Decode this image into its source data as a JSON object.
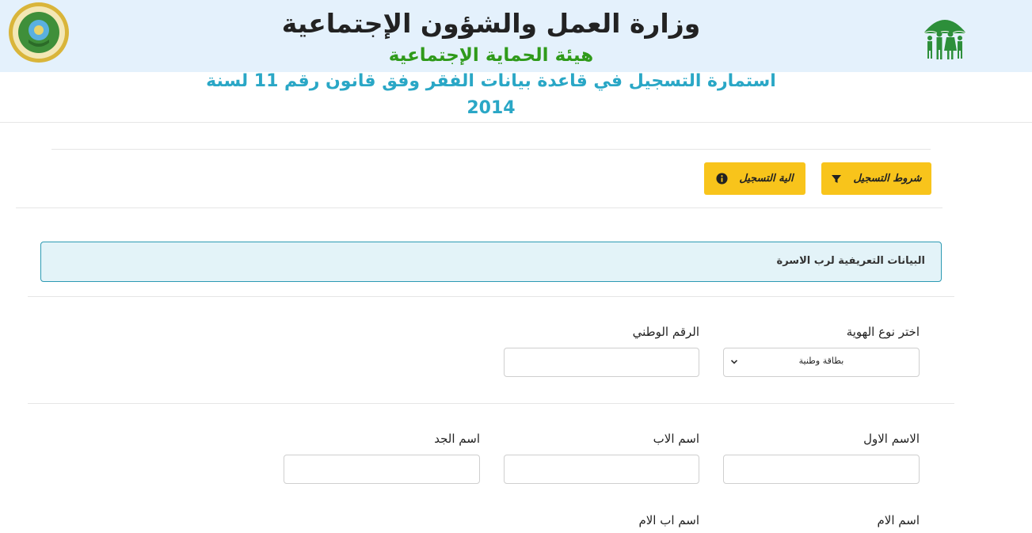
{
  "header": {
    "ministry": "وزارة العمل والشؤون الإجتماعية",
    "authority": "هيئة الحماية الإجتماعية",
    "form_title": "استمارة التسجيل في قاعدة بيانات الفقر وفق قانون رقم 11 لسنة 2014"
  },
  "colors": {
    "header_bg": "#e4f1fc",
    "authority_green": "#2f9a1a",
    "title_teal": "#2aa7c6",
    "button_yellow": "#f8c41b",
    "panel_bg": "#e3f3f8",
    "panel_border": "#2d9ab3"
  },
  "buttons": {
    "conditions": {
      "label": "شروط التسجيل",
      "icon": "filter-icon"
    },
    "mechanism": {
      "label": "الية التسجيل",
      "icon": "info-circle-icon"
    }
  },
  "section": {
    "title": "البيانات التعريفية لرب الاسرة"
  },
  "form": {
    "id_type": {
      "label": "اختر نوع الهوية",
      "value": "بطاقة وطنية"
    },
    "national_id": {
      "label": "الرقم الوطني",
      "value": ""
    },
    "first_name": {
      "label": "الاسم الاول",
      "value": ""
    },
    "father_name": {
      "label": "اسم الاب",
      "value": ""
    },
    "grandfather_name": {
      "label": "اسم الجد",
      "value": ""
    },
    "mother_name": {
      "label": "اسم الام"
    },
    "mother_father_name": {
      "label": "اسم اب الام"
    }
  }
}
